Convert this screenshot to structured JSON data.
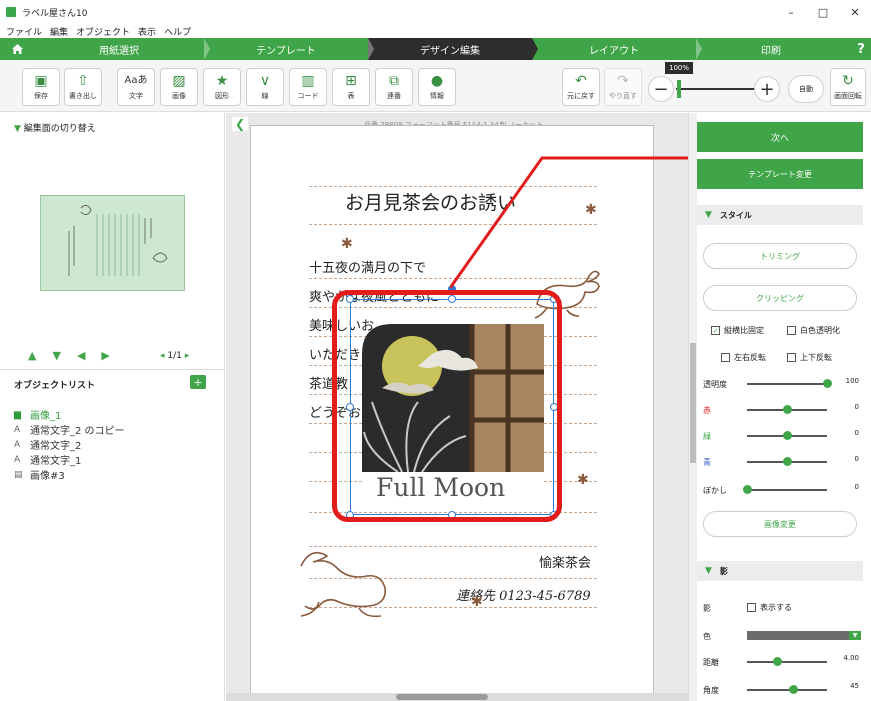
{
  "window": {
    "title": "ラベル屋さん10",
    "minimize": "–",
    "maximize": "□",
    "close": "✕"
  },
  "menu": [
    "ファイル",
    "編集",
    "オブジェクト",
    "表示",
    "ヘルプ"
  ],
  "steps": {
    "home_icon": "home-icon",
    "items": [
      "用紙選択",
      "テンプレート",
      "デザイン編集",
      "レイアウト",
      "印刷"
    ],
    "active": "デザイン編集",
    "help": "?"
  },
  "toolbar": {
    "buttons": [
      {
        "label": "保存",
        "icon": "save-icon"
      },
      {
        "label": "書き出し",
        "icon": "export-icon"
      },
      {
        "label": "文字",
        "icon": "text-icon",
        "glyph": "Aaあ"
      },
      {
        "label": "画像",
        "icon": "image-icon"
      },
      {
        "label": "図形",
        "icon": "shape-icon"
      },
      {
        "label": "線",
        "icon": "line-icon"
      },
      {
        "label": "コード",
        "icon": "barcode-icon"
      },
      {
        "label": "表",
        "icon": "table-icon"
      },
      {
        "label": "連番",
        "icon": "sequence-icon"
      },
      {
        "label": "情報",
        "icon": "person-icon"
      }
    ],
    "undo_label": "元に戻す",
    "redo_label": "やり直す",
    "zoom_level": "100%",
    "zoom_auto": "自動",
    "rotate_label": "画面回転"
  },
  "left_panel": {
    "switch_header": "編集面の切り替え",
    "page_count": "1/1",
    "object_list_title": "オブジェクトリスト",
    "objects": [
      {
        "name": "画像_1",
        "icon": "image-object-icon",
        "selected": true
      },
      {
        "name": "通常文字_2 のコピー",
        "icon": "text-object-icon",
        "selected": false
      },
      {
        "name": "通常文字_2",
        "icon": "text-object-icon",
        "selected": false
      },
      {
        "name": "通常文字_1",
        "icon": "text-object-icon",
        "selected": false
      },
      {
        "name": "画像#3",
        "icon": "image-object-icon",
        "selected": false
      }
    ]
  },
  "canvas": {
    "page_info": "品番 28809 フォーマット番号 F1A4-1 A4判 ノーカット",
    "card_title": "お月見茶会のお誘い",
    "body_lines": [
      "十五夜の満月の下で",
      "爽やかな夜風とともに",
      "美味しいお",
      "いただき",
      "茶道教",
      "どうぞお"
    ],
    "image_caption": "Full Moon",
    "signature": "愉楽茶会",
    "contact": "連絡先 0123-45-6789"
  },
  "right_panel": {
    "next_label": "次へ",
    "template_change_label": "テンプレート変更",
    "style_header": "スタイル",
    "trimming_label": "トリミング",
    "clipping_label": "クリッピング",
    "checks": {
      "keep_ratio": {
        "label": "縦横比固定",
        "checked": true
      },
      "white_transparent": {
        "label": "白色透明化",
        "checked": false
      },
      "flip_h": {
        "label": "左右反転",
        "checked": false
      },
      "flip_v": {
        "label": "上下反転",
        "checked": false
      }
    },
    "sliders": [
      {
        "label": "透明度",
        "value": "100",
        "color": "#222222",
        "fraction": 1.0
      },
      {
        "label": "赤",
        "value": "0",
        "color": "#e21b1b",
        "fraction": 0.5
      },
      {
        "label": "緑",
        "value": "0",
        "color": "#3fa548",
        "fraction": 0.5
      },
      {
        "label": "青",
        "value": "0",
        "color": "#2f5fc4",
        "fraction": 0.5
      },
      {
        "label": "ぼかし",
        "value": "0",
        "color": "#222222",
        "fraction": 0.0
      }
    ],
    "image_change_label": "画像変更",
    "shadow_header": "影",
    "shadow": {
      "label": "影",
      "show_label": "表示する",
      "color_label": "色",
      "distance_label": "距離",
      "distance_value": "4.00",
      "angle_label": "角度",
      "angle_value": "45"
    }
  },
  "colors": {
    "accent": "#3fa548",
    "selection": "#2f7ad4",
    "highlight": "#e21b1b"
  }
}
